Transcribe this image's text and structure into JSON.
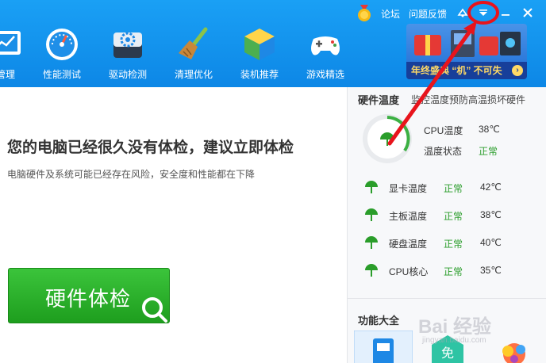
{
  "header": {
    "nav": [
      {
        "label": "管理",
        "icon": "chart-window-icon"
      },
      {
        "label": "性能测试",
        "icon": "speedometer-icon"
      },
      {
        "label": "驱动检测",
        "icon": "gear-chip-icon"
      },
      {
        "label": "清理优化",
        "icon": "broom-icon"
      },
      {
        "label": "装机推荐",
        "icon": "cube-icon"
      },
      {
        "label": "游戏精选",
        "icon": "gamepad-icon"
      }
    ],
    "topbar": {
      "forum": "论坛",
      "feedback": "问题反馈",
      "medal_icon": "medal-icon",
      "skin_icon": "skin-icon",
      "menu_icon": "dropdown-menu-icon",
      "minimize_icon": "minimize-icon",
      "close_icon": "close-icon"
    },
    "banner": {
      "promo_text": "年终盛典 “机” 不可失",
      "icon": "promo-go-icon"
    }
  },
  "main": {
    "headline": "您的电脑已经很久没有体检，建议立即体检",
    "subline": "电脑硬件及系统可能已经存在风险，安全度和性能都在下降",
    "check_button": "硬件体检"
  },
  "panel": {
    "temp_title": "硬件温度",
    "temp_subtitle": "监控温度预防高温损坏硬件",
    "cpu_temp_label": "CPU温度",
    "cpu_temp_value": "38℃",
    "temp_status_label": "温度状态",
    "temp_status_value": "正常",
    "rows": [
      {
        "name": "显卡温度",
        "status": "正常",
        "value": "42℃"
      },
      {
        "name": "主板温度",
        "status": "正常",
        "value": "38℃"
      },
      {
        "name": "硬盘温度",
        "status": "正常",
        "value": "40℃"
      },
      {
        "name": "CPU核心",
        "status": "正常",
        "value": "35℃"
      }
    ],
    "features_title": "功能大全",
    "tools": [
      "device-manager-icon",
      "free-badge-icon",
      "colorful-app-icon"
    ]
  },
  "watermark": {
    "text": "Bai 经验",
    "sub": "jingyan.baidu.com"
  },
  "colors": {
    "header_blue": "#0d87e6",
    "accent_green": "#2a9d2a",
    "button_green": "#1e9e1e",
    "annotation_red": "#e8141c"
  }
}
